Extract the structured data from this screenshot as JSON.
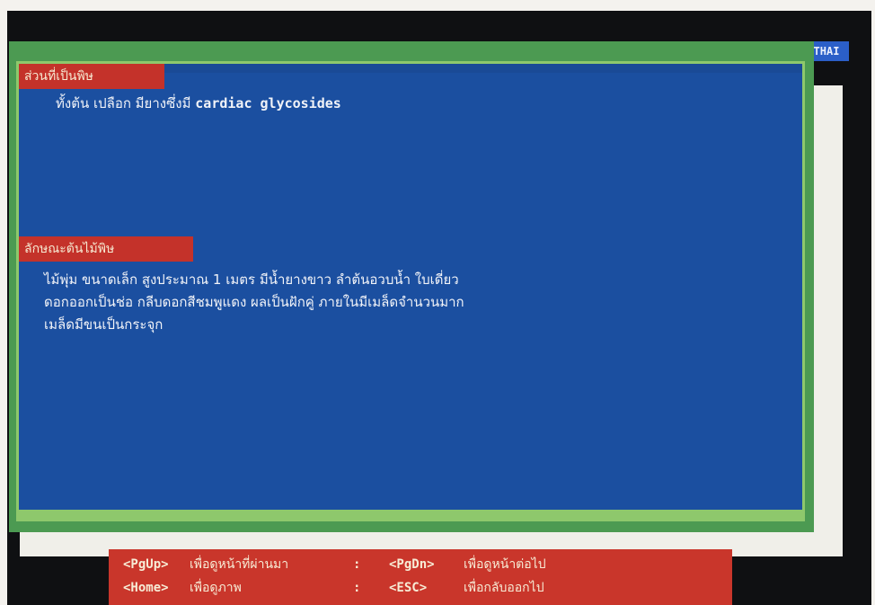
{
  "badge": {
    "label": "THAI"
  },
  "sections": [
    {
      "label": "ส่วนที่เป็นพิษ",
      "lines": [
        "ทั้งต้น เปลือก มียางซึ่งมี cardiac glycosides"
      ]
    },
    {
      "label": "ลักษณะต้นไม้พิษ",
      "lines": [
        "ไม้พุ่ม ขนาดเล็ก สูงประมาณ 1 เมตร มีน้ำยางขาว ลำต้นอวบน้ำ ใบเดี่ยว",
        "ดอกออกเป็นช่อ กลีบดอกสีชมพูแดง ผลเป็นฝักคู่ ภายในมีเมล็ดจำนวนมาก",
        "เมล็ดมีขนเป็นกระจุก"
      ]
    }
  ],
  "footer": {
    "rows": [
      [
        {
          "key": "<PgUp>",
          "desc": "เพื่อดูหน้าที่ผ่านมา"
        },
        {
          "key": "<PgDn>",
          "desc": "เพื่อดูหน้าต่อไป"
        }
      ],
      [
        {
          "key": "<Home>",
          "desc": "เพื่อดูภาพ"
        },
        {
          "key": "<ESC>",
          "desc": "เพื่อกลับออกไป"
        }
      ]
    ],
    "separator": ":"
  },
  "colors": {
    "panel": "#1b4fa0",
    "frame": "#4c9a52",
    "label": "#c4322a",
    "footer": "#c9362b"
  }
}
